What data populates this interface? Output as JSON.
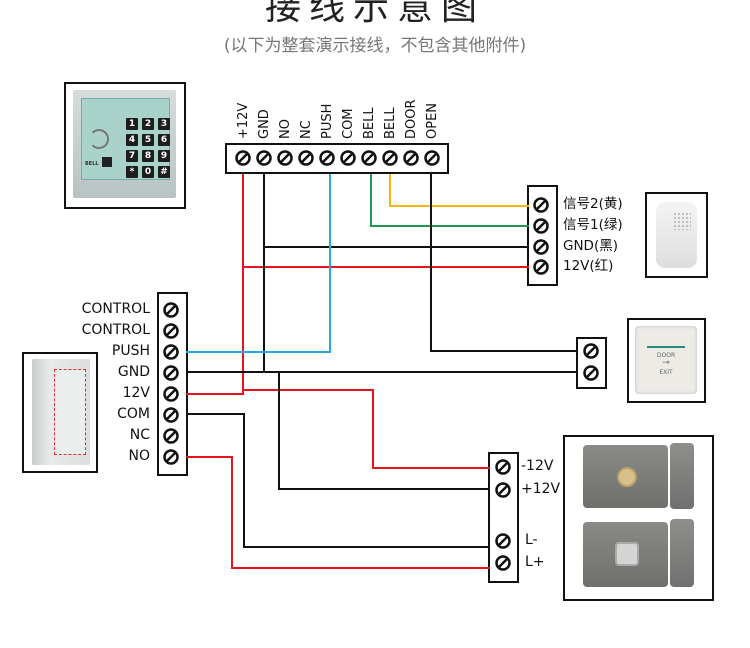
{
  "title": "接线示意图",
  "subtitle": "(以下为整套演示接线，不包含其他附件)",
  "top_terminal": {
    "labels": [
      "+12V",
      "GND",
      "NO",
      "NC",
      "PUSH",
      "COM",
      "BELL",
      "BELL",
      "DOOR",
      "OPEN"
    ]
  },
  "controller_terminal": {
    "labels": [
      "CONTROL",
      "CONTROL",
      "PUSH",
      "GND",
      "12V",
      "COM",
      "NC",
      "NO"
    ]
  },
  "doorbell_terminal": {
    "labels": [
      "信号2(黄)",
      "信号1(绿)",
      "GND(黑)",
      "12V(红)"
    ]
  },
  "lock_terminal": {
    "labels": [
      "-12V",
      "+12V",
      "L-",
      "L+"
    ]
  },
  "keypad": {
    "keys": [
      "1",
      "2",
      "3",
      "4",
      "5",
      "6",
      "7",
      "8",
      "9",
      "*",
      "0",
      "#"
    ],
    "bell_label": "BELL",
    "icon": "rfid-keypad"
  },
  "exit_button": {
    "line1": "DOOR",
    "line2": "EXIT",
    "icon": "key-icon"
  },
  "colors": {
    "red": "#e8141c",
    "black": "#111111",
    "blue": "#29a8e0",
    "green": "#1a9a4a",
    "yellow": "#f2b90f"
  }
}
